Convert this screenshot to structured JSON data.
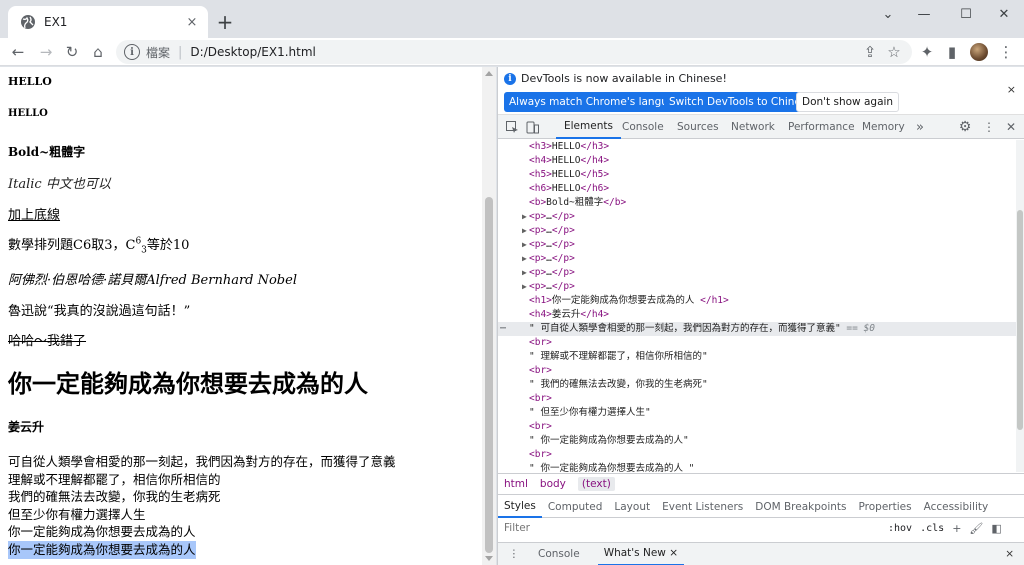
{
  "browser": {
    "tab_title": "EX1",
    "tab_close_icon": "×",
    "new_tab_icon": "+",
    "window_controls": {
      "dropdown": "⌄",
      "minimize": "—",
      "maximize": "☐",
      "close": "✕"
    },
    "nav": {
      "back": "←",
      "forward": "→",
      "reload": "↻",
      "home": "⌂"
    },
    "address": {
      "security_label": "檔案",
      "url": "D:/Desktop/EX1.html"
    },
    "right_icons": {
      "share": "⇪",
      "bookmark": "☆",
      "extensions": "✦",
      "sidepanel": "▮",
      "menu": "⋮"
    }
  },
  "page": {
    "h3": "HELLO",
    "h4": "HELLO",
    "bold": "Bold~粗體字",
    "italic": "Italic 中文也可以",
    "underline": "加上底線",
    "math": {
      "prefix": "數學排列題C6取3，C",
      "sup": "6",
      "sub": "3",
      "suffix": "等於10"
    },
    "nobel": "阿佛烈·伯恩哈德·諾貝爾Alfred Bernhard Nobel",
    "quote": "魯迅說“我真的沒說過這句話！”",
    "strike": "哈哈～我錯了",
    "h1": "你一定能夠成為你想要去成為的人",
    "name": "姜云升",
    "lines": [
      "可自從人類學會相愛的那一刻起，我們因為對方的存在，而獲得了意義",
      "理解或不理解都罷了，相信你所相信的",
      "我們的確無法去改變，你我的生老病死",
      "但至少你有權力選擇人生",
      "你一定能夠成為你想要去成為的人"
    ],
    "selected_line": "你一定能夠成為你想要去成為的人"
  },
  "devtools": {
    "infobar": {
      "message": "DevTools is now available in Chinese!",
      "btn_match": "Always match Chrome's language",
      "btn_switch": "Switch DevTools to Chinese",
      "btn_dismiss": "Don't show again",
      "close": "×"
    },
    "tabs": [
      "Elements",
      "Console",
      "Sources",
      "Network",
      "Performance",
      "Memory"
    ],
    "more_tabs": "»",
    "elements": {
      "h3": "HELLO",
      "h4": "HELLO",
      "h5": "HELLO",
      "h6": "HELLO",
      "b": "Bold~粗體字",
      "p_collapsed": "…",
      "h1": "你一定能夠成為你想要去成為的人 ",
      "h4_name": "姜云升",
      "selected_text": "\" 可自從人類學會相愛的那一刻起，我們因為對方的存在，而獲得了意義\"",
      "selected_marker": "== $0",
      "text_nodes": [
        "\" 理解或不理解都罷了，相信你所相信的\"",
        "\" 我們的確無法去改變，你我的生老病死\"",
        "\" 但至少你有權力選擇人生\"",
        "\" 你一定能夠成為你想要去成為的人\"",
        "\" 你一定能夠成為你想要去成為的人 \""
      ],
      "br": "<br>"
    },
    "breadcrumbs": [
      "html",
      "body",
      "(text)"
    ],
    "styles_tabs": [
      "Styles",
      "Computed",
      "Layout",
      "Event Listeners",
      "DOM Breakpoints",
      "Properties",
      "Accessibility"
    ],
    "filter_placeholder": "Filter",
    "filter_hov": ":hov",
    "filter_cls": ".cls",
    "drawer": {
      "console": "Console",
      "whats_new": "What's New",
      "close_tab": "×",
      "close": "×"
    }
  }
}
